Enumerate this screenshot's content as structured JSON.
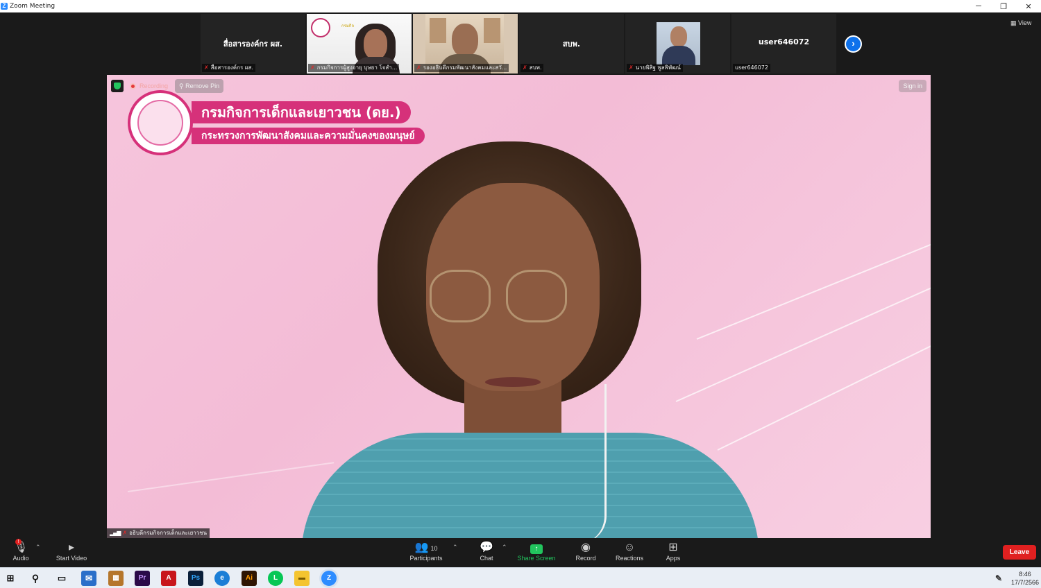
{
  "window": {
    "title": "Zoom Meeting",
    "controls": [
      "─",
      "❐",
      "✕"
    ]
  },
  "strip": {
    "tiles": [
      {
        "big_name": "สื่อสารองค์กร ผส.",
        "name_tag": "สื่อสารองค์กร ผส.",
        "muted": true,
        "video": false
      },
      {
        "big_name": "",
        "name_tag": "กรมกิจการผู้สูงอายุ บุษยา โจสำ...",
        "muted": true,
        "video": true
      },
      {
        "big_name": "",
        "name_tag": "รองอธิบดีกรมพัฒนาสังคมและสวั...",
        "muted": true,
        "video": true
      },
      {
        "big_name": "สบพ.",
        "name_tag": "สบพ.",
        "muted": true,
        "video": false
      },
      {
        "big_name": "",
        "name_tag": "นายพิสิฐ พูลพิพัฒน์",
        "muted": true,
        "video": true
      },
      {
        "big_name": "user646072",
        "name_tag": "user646072",
        "muted": false,
        "video": false
      }
    ],
    "next_icon": "›",
    "view_label": "View"
  },
  "stage": {
    "banner_line1": "กรมกิจการเด็กและเยาวชน (ดย.)",
    "banner_line2": "กระทรวงการพัฒนาสังคมและความมั่นคงของมนุษย์",
    "recording_label": "Recording",
    "remove_pin_label": "Remove Pin",
    "sign_in_label": "Sign in",
    "speaker_name": "อธิบดีกรมกิจการเด็กและเยาวชน"
  },
  "toolbar": {
    "audio_label": "Audio",
    "start_video_label": "Start Video",
    "participants_label": "Participants",
    "participants_count": "10",
    "chat_label": "Chat",
    "share_screen_label": "Share Screen",
    "record_label": "Record",
    "reactions_label": "Reactions",
    "apps_label": "Apps",
    "leave_label": "Leave",
    "audio_badge": "!"
  },
  "taskbar": {
    "apps": [
      "Pr",
      "Ps",
      "Ai"
    ],
    "time": "8:46",
    "date": "17/7/2566"
  },
  "colors": {
    "zoom_blue": "#0e71eb",
    "leave_red": "#e02020",
    "share_green": "#22c55e",
    "banner_pink": "#d6317a"
  }
}
